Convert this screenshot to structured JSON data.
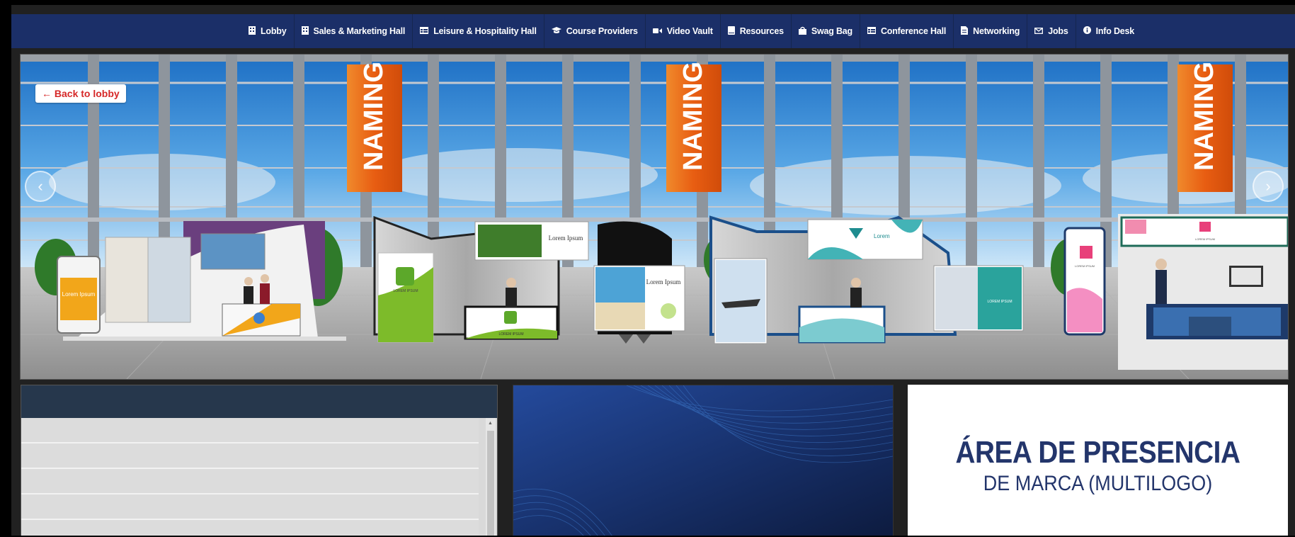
{
  "nav": {
    "items": [
      {
        "label": "Lobby",
        "icon": "building-icon"
      },
      {
        "label": "Sales & Marketing Hall",
        "icon": "building-icon"
      },
      {
        "label": "Leisure & Hospitality Hall",
        "icon": "table-icon"
      },
      {
        "label": "Course Providers",
        "icon": "graduation-cap-icon"
      },
      {
        "label": "Video Vault",
        "icon": "video-camera-icon"
      },
      {
        "label": "Resources",
        "icon": "book-icon"
      },
      {
        "label": "Swag Bag",
        "icon": "shopping-bag-icon"
      },
      {
        "label": "Conference Hall",
        "icon": "table-icon"
      },
      {
        "label": "Networking",
        "icon": "file-icon"
      },
      {
        "label": "Jobs",
        "icon": "envelope-icon"
      },
      {
        "label": "Info Desk",
        "icon": "info-circle-icon"
      }
    ]
  },
  "hall": {
    "back_label": "← Back to lobby",
    "banner_text": "NAMING",
    "booths": {
      "booth1_screen": "Lorem Ipsum",
      "booth2_sign": "Lorem Ipsum",
      "booth2_panel": "LOREM IPSUM",
      "booth2_desk": "LOREM IPSUM",
      "booth3_sign": "Lorem Ipsum",
      "booth4_sign": "Lorem",
      "booth4_panel": "LOREM IPSUM",
      "booth5_sign": "LOREM IPSUM",
      "booth5_kiosk": "LOREM IPSUM"
    }
  },
  "branding": {
    "line1": "ÁREA DE PRESENCIA",
    "line2": "DE MARCA (MULTILOGO)"
  },
  "colors": {
    "nav_bg": "#1b2f68",
    "banner_orange": "#e8651c",
    "back_text": "#d62828",
    "brand_text": "#23356b"
  }
}
